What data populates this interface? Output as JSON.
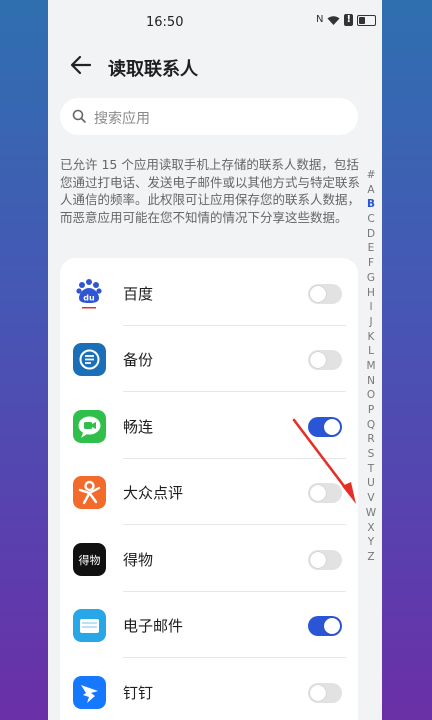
{
  "status": {
    "time": "16:50",
    "nfc": "N",
    "wifi": "wifi",
    "alert": "!"
  },
  "header": {
    "title": "读取联系人"
  },
  "search": {
    "placeholder": "搜索应用"
  },
  "description": "已允许 15 个应用读取手机上存储的联系人数据，包括您通过打电话、发送电子邮件或以其他方式与特定联系人通信的频率。此权限可让应用保存您的联系人数据，而恶意应用可能在您不知情的情况下分享这些数据。",
  "apps": [
    {
      "name": "百度",
      "icon": "baidu-icon",
      "enabled": false
    },
    {
      "name": "备份",
      "icon": "backup-icon",
      "enabled": false
    },
    {
      "name": "畅连",
      "icon": "meetime-icon",
      "enabled": true
    },
    {
      "name": "大众点评",
      "icon": "dianping-icon",
      "enabled": false
    },
    {
      "name": "得物",
      "icon": "dewu-icon",
      "enabled": false
    },
    {
      "name": "电子邮件",
      "icon": "email-icon",
      "enabled": true
    },
    {
      "name": "钉钉",
      "icon": "dingtalk-icon",
      "enabled": false
    }
  ],
  "icon_text": {
    "baidu": "du",
    "dewu": "得物"
  },
  "alphabet": [
    "#",
    "A",
    "B",
    "C",
    "D",
    "E",
    "F",
    "G",
    "H",
    "I",
    "J",
    "K",
    "L",
    "M",
    "N",
    "O",
    "P",
    "Q",
    "R",
    "S",
    "T",
    "U",
    "V",
    "W",
    "X",
    "Y",
    "Z"
  ],
  "alphabet_active": "B",
  "colors": {
    "accent": "#2a56d6",
    "toggle_off": "#e2e2e2",
    "annotation_arrow": "#e5302a"
  }
}
